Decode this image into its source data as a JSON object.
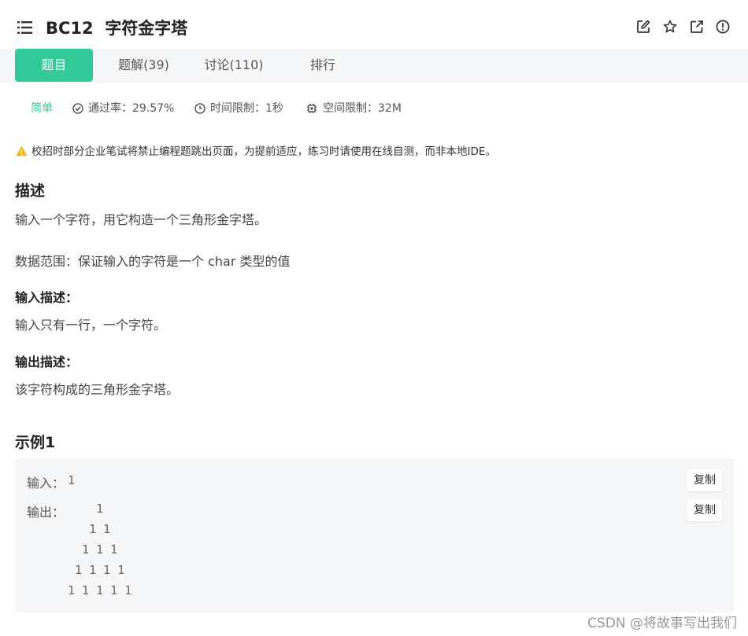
{
  "header": {
    "title": "BC12  字符金字塔",
    "icons": [
      "list-icon",
      "edit-icon",
      "star-icon",
      "external-link-icon",
      "alert-icon"
    ]
  },
  "tabs": [
    {
      "label": "题目",
      "active": true
    },
    {
      "label": "题解(39)",
      "active": false
    },
    {
      "label": "讨论(110)",
      "active": false
    },
    {
      "label": "排行",
      "active": false
    }
  ],
  "meta": {
    "difficulty": "简单",
    "pass_rate": "通过率：29.57%",
    "time_limit": "时间限制：1秒",
    "memory_limit": "空间限制：32M"
  },
  "warning": "校招时部分企业笔试将禁止编程题跳出页面，为提前适应，练习时请使用在线自测，而非本地IDE。",
  "description": {
    "heading": "描述",
    "text1": "输入一个字符，用它构造一个三角形金字塔。",
    "text2": "数据范围：保证输入的字符是一个 char 类型的值"
  },
  "input_desc": {
    "heading": "输入描述：",
    "text": "输入只有一行，一个字符。"
  },
  "output_desc": {
    "heading": "输出描述：",
    "text": "该字符构成的三角形金字塔。"
  },
  "example": {
    "heading": "示例1",
    "input_label": "输入：",
    "input_value": "1",
    "output_label": "输出：",
    "output_value": "    1\n   1 1\n  1 1 1\n 1 1 1 1\n1 1 1 1 1",
    "copy_label": "复制"
  },
  "watermark": "CSDN @将故事写出我们",
  "colors": {
    "accent": "#32ca99",
    "tabbar_bg": "#f5f7f9",
    "example_bg": "#f5f6f8",
    "warning": "#f5b50a"
  }
}
